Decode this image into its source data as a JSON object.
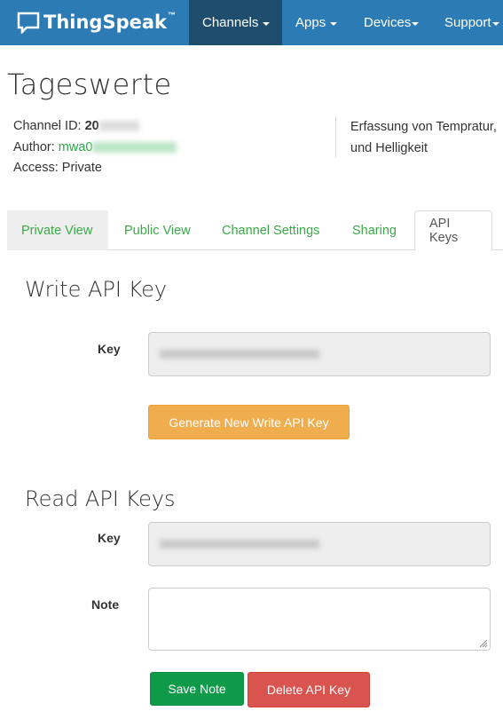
{
  "navbar": {
    "brand": "ThingSpeak",
    "brand_tm": "™",
    "brand_icon": "speech-bubble-icon",
    "items": [
      {
        "label": "Channels",
        "active": true
      },
      {
        "label": "Apps",
        "active": false
      },
      {
        "label": "Devices",
        "active": false
      },
      {
        "label": "Support",
        "active": false
      }
    ]
  },
  "channel": {
    "title": "Tageswerte",
    "channel_id_label": "Channel ID:",
    "channel_id_visible": "20",
    "author_label": "Author:",
    "author_visible": "mwa0",
    "access_label": "Access:",
    "access_value": "Private",
    "description": "Erfassung von Tempratur, und Helligkeit"
  },
  "tabs": [
    {
      "label": "Private View",
      "active": false
    },
    {
      "label": "Public View",
      "active": false
    },
    {
      "label": "Channel Settings",
      "active": false
    },
    {
      "label": "Sharing",
      "active": false
    },
    {
      "label": "API Keys",
      "active": true
    }
  ],
  "write_section": {
    "heading": "Write API Key",
    "key_label": "Key",
    "key_value": "(redacted)",
    "generate_button": "Generate New Write API Key"
  },
  "read_section": {
    "heading": "Read API Keys",
    "key_label": "Key",
    "key_value": "(redacted)",
    "note_label": "Note",
    "note_value": "",
    "save_button": "Save Note",
    "delete_button": "Delete API Key"
  },
  "colors": {
    "navbar": "#2c7bb5",
    "navbar_active": "#1f4d6e",
    "link_green": "#3aa948",
    "warning": "#f0ad4e",
    "success": "#0f9a4a",
    "danger": "#d9534f"
  }
}
